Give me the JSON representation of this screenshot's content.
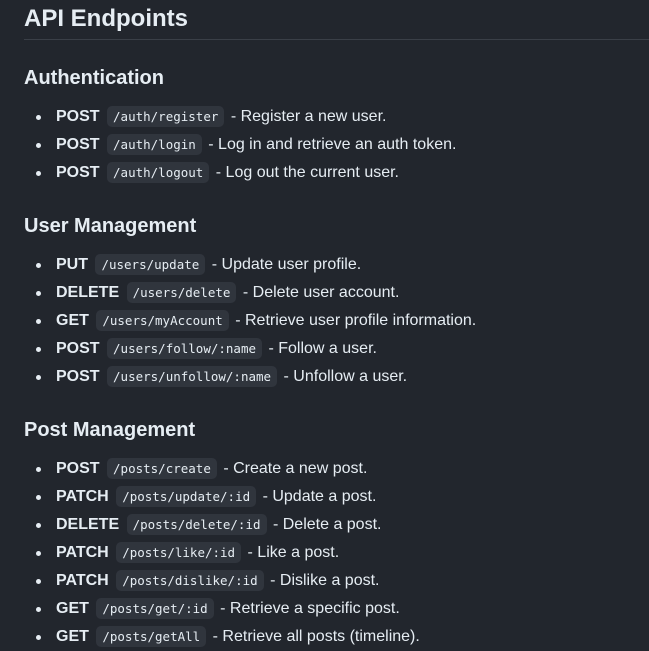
{
  "title": "API Endpoints",
  "sections": [
    {
      "heading": "Authentication",
      "endpoints": [
        {
          "method": "POST",
          "path": "/auth/register",
          "desc": "- Register a new user."
        },
        {
          "method": "POST",
          "path": "/auth/login",
          "desc": "- Log in and retrieve an auth token."
        },
        {
          "method": "POST",
          "path": "/auth/logout",
          "desc": "- Log out the current user."
        }
      ]
    },
    {
      "heading": "User Management",
      "endpoints": [
        {
          "method": "PUT",
          "path": "/users/update",
          "desc": "- Update user profile."
        },
        {
          "method": "DELETE",
          "path": "/users/delete",
          "desc": "- Delete user account."
        },
        {
          "method": "GET",
          "path": "/users/myAccount",
          "desc": "- Retrieve user profile information."
        },
        {
          "method": "POST",
          "path": "/users/follow/:name",
          "desc": "- Follow a user."
        },
        {
          "method": "POST",
          "path": "/users/unfollow/:name",
          "desc": "- Unfollow a user."
        }
      ]
    },
    {
      "heading": "Post Management",
      "endpoints": [
        {
          "method": "POST",
          "path": "/posts/create",
          "desc": "- Create a new post."
        },
        {
          "method": "PATCH",
          "path": "/posts/update/:id",
          "desc": "- Update a post."
        },
        {
          "method": "DELETE",
          "path": "/posts/delete/:id",
          "desc": "- Delete a post."
        },
        {
          "method": "PATCH",
          "path": "/posts/like/:id",
          "desc": "- Like a post."
        },
        {
          "method": "PATCH",
          "path": "/posts/dislike/:id",
          "desc": "- Dislike a post."
        },
        {
          "method": "GET",
          "path": "/posts/get/:id",
          "desc": "- Retrieve a specific post."
        },
        {
          "method": "GET",
          "path": "/posts/getAll",
          "desc": "- Retrieve all posts (timeline)."
        }
      ]
    }
  ]
}
